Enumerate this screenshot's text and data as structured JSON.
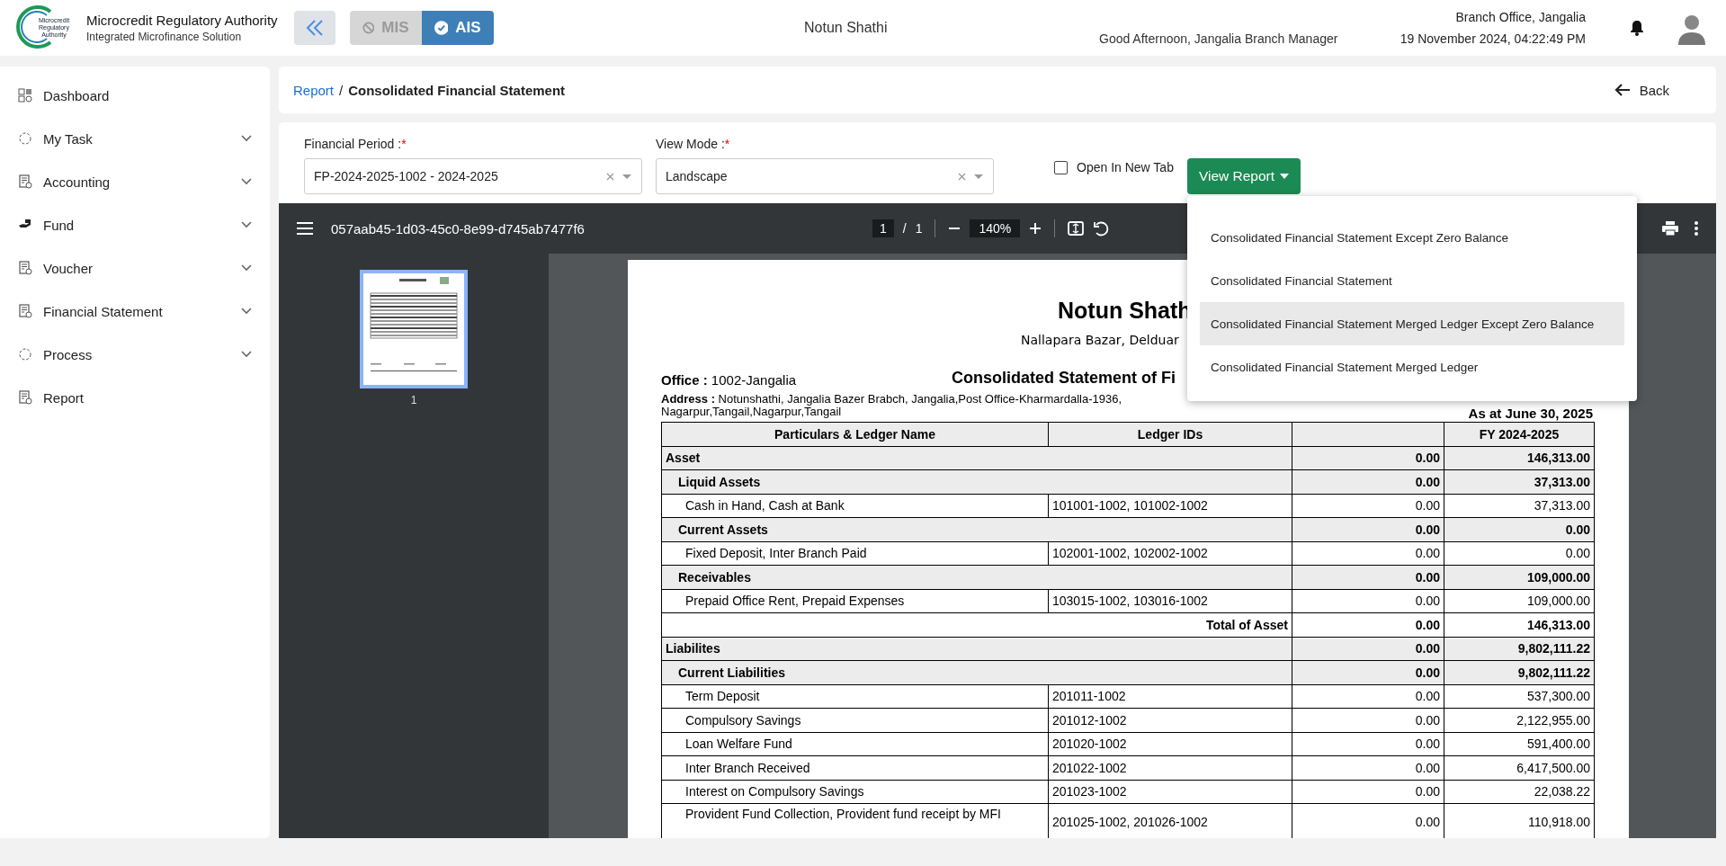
{
  "header": {
    "logo_text": [
      "Microcredit",
      "Regulatory",
      "Authority"
    ],
    "title": "Microcredit Regulatory Authority",
    "subtitle": "Integrated Microfinance Solution",
    "modes": [
      {
        "label": "MIS",
        "selected": false
      },
      {
        "label": "AIS",
        "selected": true
      }
    ],
    "organization": "Notun Shathi",
    "greeting": "Good Afternoon, Jangalia Branch Manager",
    "branch": "Branch Office, Jangalia",
    "datetime": "19 November 2024, 04:22:49 PM"
  },
  "sidebar": {
    "items": [
      {
        "label": "Dashboard",
        "has_submenu": false
      },
      {
        "label": "My Task",
        "has_submenu": true
      },
      {
        "label": "Accounting",
        "has_submenu": true
      },
      {
        "label": "Fund",
        "has_submenu": true
      },
      {
        "label": "Voucher",
        "has_submenu": true
      },
      {
        "label": "Financial Statement",
        "has_submenu": true
      },
      {
        "label": "Process",
        "has_submenu": true
      },
      {
        "label": "Report",
        "has_submenu": false
      }
    ]
  },
  "breadcrumb": {
    "parent": "Report",
    "separator": "/",
    "current": "Consolidated Financial Statement",
    "back": "Back"
  },
  "form": {
    "fields": [
      {
        "label": "Financial Period :",
        "required_mark": "*",
        "value": "FP-2024-2025-1002 - 2024-2025"
      },
      {
        "label": "View Mode :",
        "required_mark": "*",
        "value": "Landscape"
      }
    ],
    "open_in_new_tab": {
      "label": "Open In New Tab",
      "checked": false
    },
    "view_report": "View Report"
  },
  "dropdown": {
    "items": [
      {
        "label": "Consolidated Financial Statement Except Zero Balance",
        "hovered": false
      },
      {
        "label": "Consolidated Financial Statement",
        "hovered": false
      },
      {
        "label": "Consolidated Financial Statement Merged Ledger Except Zero Balance",
        "hovered": true
      },
      {
        "label": "Consolidated Financial Statement Merged Ledger",
        "hovered": false
      }
    ]
  },
  "viewer": {
    "file_name": "057aab45-1d03-45c0-8e99-d745ab7477f6",
    "page": "1",
    "separator": "/",
    "page_count": "1",
    "zoom": "140%",
    "thumbnails": [
      {
        "label": "1",
        "selected": true
      }
    ]
  },
  "document": {
    "title": "Notun Shath",
    "address_line": "Nallapara Bazar, Delduar",
    "office": "**Office :** 1002-Jangalia",
    "heading": "Consolidated Statement of Fi",
    "address": "**Address :** Notunshathi, Jangalia Bazer Brabch, Jangalia,Post Office-Kharmardalla-1936,",
    "address_2": "Nagarpur,Tangail,Nagarpur,Tangail",
    "as_at": "As at June 30, 2025",
    "table": {
      "columns": [
        "Particulars & Ledger Name",
        "Ledger IDs",
        "FY 2024-2025"
      ],
      "rows": [
        {
          "kind": "group",
          "name": "Asset",
          "prev": "0.00",
          "amount": "146,313.00"
        },
        {
          "kind": "subgroup",
          "name": "Liquid Assets",
          "prev": "0.00",
          "amount": "37,313.00"
        },
        {
          "kind": "ledger",
          "name": "Cash in Hand, Cash at Bank",
          "ids": "101001-1002, 101002-1002",
          "prev": "0.00",
          "amount": "37,313.00"
        },
        {
          "kind": "subgroup",
          "name": "Current Assets",
          "prev": "0.00",
          "amount": "0.00"
        },
        {
          "kind": "ledger",
          "name": "Fixed Deposit, Inter Branch Paid",
          "ids": "102001-1002, 102002-1002",
          "prev": "0.00",
          "amount": "0.00"
        },
        {
          "kind": "subgroup",
          "name": "Receivables",
          "prev": "0.00",
          "amount": "109,000.00"
        },
        {
          "kind": "ledger",
          "name": "Prepaid Office Rent, Prepaid Expenses",
          "ids": "103015-1002, 103016-1002",
          "prev": "0.00",
          "amount": "109,000.00"
        },
        {
          "kind": "total",
          "total_label": "Total of Asset",
          "prev": "0.00",
          "amount": "146,313.00"
        },
        {
          "kind": "group",
          "name": "Liabilites",
          "prev": "0.00",
          "amount": "9,802,111.22"
        },
        {
          "kind": "subgroup",
          "name": "Current Liabilities",
          "prev": "0.00",
          "amount": "9,802,111.22"
        },
        {
          "kind": "ledger",
          "name": "Term Deposit",
          "ids": "201011-1002",
          "prev": "0.00",
          "amount": "537,300.00"
        },
        {
          "kind": "ledger",
          "name": "Compulsory Savings",
          "ids": "201012-1002",
          "prev": "0.00",
          "amount": "2,122,955.00"
        },
        {
          "kind": "ledger",
          "name": "Loan Welfare Fund",
          "ids": "201020-1002",
          "prev": "0.00",
          "amount": "591,400.00"
        },
        {
          "kind": "ledger",
          "name": "Inter Branch Received",
          "ids": "201022-1002",
          "prev": "0.00",
          "amount": "6,417,500.00"
        },
        {
          "kind": "ledger",
          "name": "Interest on Compulsory Savings",
          "ids": "201023-1002",
          "prev": "0.00",
          "amount": "22,038.22"
        },
        {
          "kind": "tall",
          "name": "Provident Fund Collection, Provident fund receipt by MFI",
          "ids": "201025-1002, 201026-1002",
          "prev": "0.00",
          "amount": "110,918.00"
        }
      ]
    }
  }
}
